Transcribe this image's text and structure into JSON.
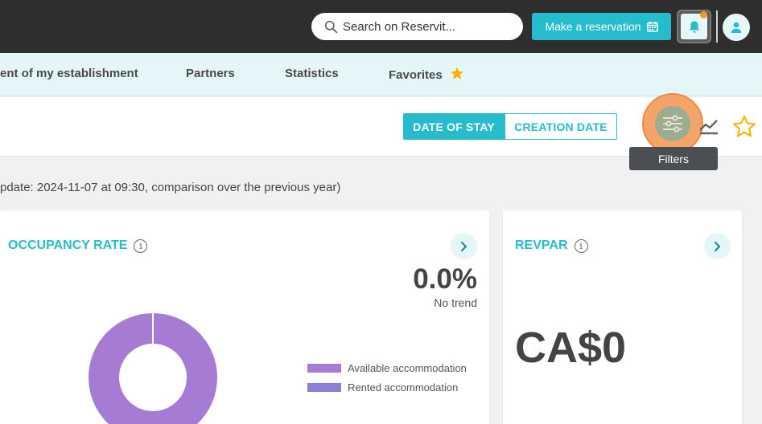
{
  "header": {
    "search_placeholder": "Search on Reservit...",
    "reserve_label": "Make a reservation",
    "icons": {
      "search": "search-icon",
      "calendar": "calendar-icon",
      "bell": "bell-icon",
      "user": "user-icon"
    },
    "notification_dot_color": "#f39a2a"
  },
  "nav": {
    "items": [
      {
        "label": "ent of my establishment"
      },
      {
        "label": "Partners"
      },
      {
        "label": "Statistics"
      },
      {
        "label": "Favorites"
      }
    ],
    "favorites_star_color": "#f5b400"
  },
  "toolbar": {
    "date_of_stay": "DATE OF STAY",
    "creation_date": "CREATION DATE",
    "filters_tooltip": "Filters",
    "accent": "#26bccb"
  },
  "update_text": "pdate: 2024-11-07 at 09:30, comparison over the previous year)",
  "occupancy": {
    "title": "OCCUPANCY RATE",
    "value": "0.0%",
    "trend": "No trend",
    "legend": [
      {
        "label": "Available accommodation",
        "color": "#a67bd3"
      },
      {
        "label": "Rented accommodation",
        "color": "#8b80d8"
      }
    ]
  },
  "revpar": {
    "title": "REVPAR",
    "value": "CA$0"
  }
}
